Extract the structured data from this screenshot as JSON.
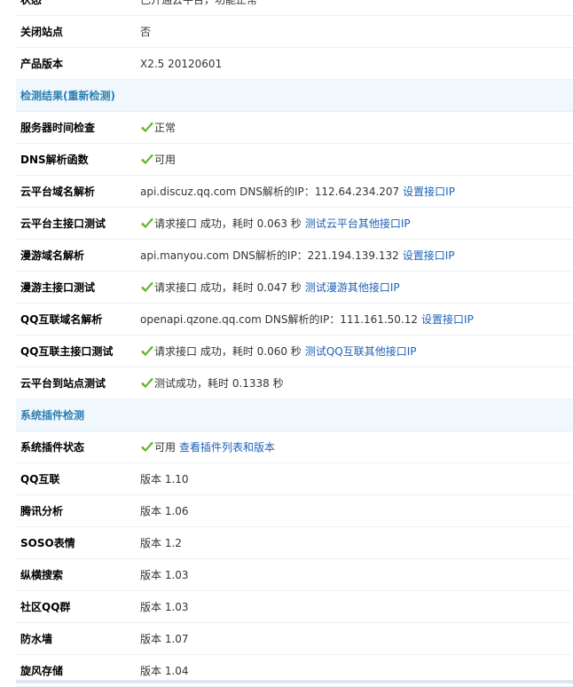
{
  "rows_top": [
    {
      "label": "状态",
      "value": "已开通云平台，功能正常"
    },
    {
      "label": "关闭站点",
      "value": "否"
    },
    {
      "label": "产品版本",
      "value": "X2.5 20120601"
    }
  ],
  "sections": {
    "check": {
      "title": "检测结果(重新检测)"
    },
    "plugins": {
      "title": "系统插件检测"
    }
  },
  "check_rows": [
    {
      "label": "服务器时间检查",
      "status": true,
      "text": "正常",
      "link": ""
    },
    {
      "label": "DNS解析函数",
      "status": true,
      "text": "可用",
      "link": ""
    },
    {
      "label": "云平台域名解析",
      "status": false,
      "text": "api.discuz.qq.com DNS解析的IP：112.64.234.207",
      "link": "设置接口IP"
    },
    {
      "label": "云平台主接口测试",
      "status": true,
      "text": "请求接口 成功，耗时 0.063 秒",
      "link": "测试云平台其他接口IP"
    },
    {
      "label": "漫游域名解析",
      "status": false,
      "text": "api.manyou.com DNS解析的IP：221.194.139.132",
      "link": "设置接口IP"
    },
    {
      "label": "漫游主接口测试",
      "status": true,
      "text": "请求接口 成功，耗时 0.047 秒",
      "link": "测试漫游其他接口IP"
    },
    {
      "label": "QQ互联域名解析",
      "status": false,
      "text": "openapi.qzone.qq.com DNS解析的IP：111.161.50.12",
      "link": "设置接口IP"
    },
    {
      "label": "QQ互联主接口测试",
      "status": true,
      "text": "请求接口 成功，耗时 0.060 秒",
      "link": "测试QQ互联其他接口IP"
    },
    {
      "label": "云平台到站点测试",
      "status": true,
      "text": "测试成功，耗时 0.1338 秒",
      "link": ""
    }
  ],
  "plugin_rows": [
    {
      "label": "系统插件状态",
      "status": true,
      "text": "可用",
      "link": "查看插件列表和版本"
    },
    {
      "label": "QQ互联",
      "status": false,
      "text": "版本 1.10",
      "link": ""
    },
    {
      "label": "腾讯分析",
      "status": false,
      "text": "版本 1.06",
      "link": ""
    },
    {
      "label": "SOSO表情",
      "status": false,
      "text": "版本 1.2",
      "link": ""
    },
    {
      "label": "纵横搜索",
      "status": false,
      "text": "版本 1.03",
      "link": ""
    },
    {
      "label": "社区QQ群",
      "status": false,
      "text": "版本 1.03",
      "link": ""
    },
    {
      "label": "防水墙",
      "status": false,
      "text": "版本 1.07",
      "link": ""
    },
    {
      "label": "旋风存储",
      "status": false,
      "text": "版本 1.04",
      "link": ""
    }
  ],
  "colors": {
    "check_green": "#5cb82a",
    "link_blue": "#1d61b5",
    "section_bg": "#f0f7fd",
    "section_text": "#2c7fb0"
  }
}
